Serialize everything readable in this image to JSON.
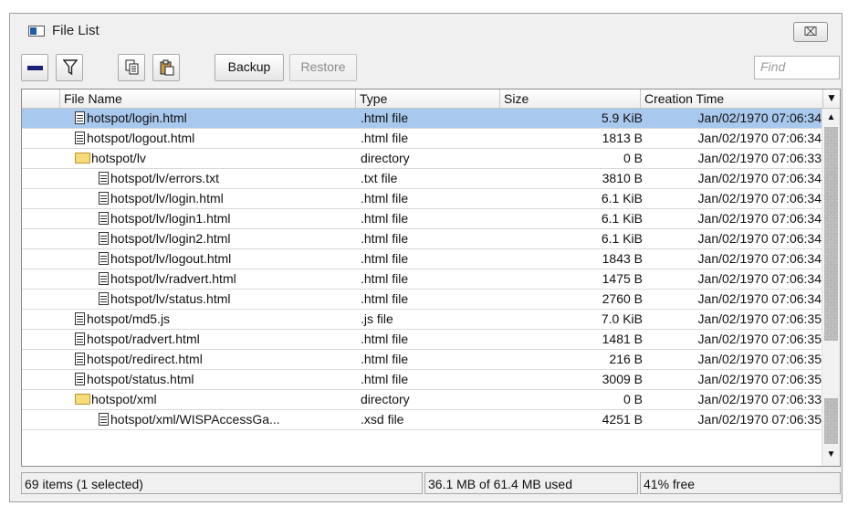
{
  "window": {
    "title": "File List",
    "close_glyph": "⌧"
  },
  "toolbar": {
    "remove_icon": "minus-icon",
    "filter_icon": "filter-icon",
    "copy_icon": "copy-icon",
    "paste_icon": "paste-icon",
    "backup_label": "Backup",
    "restore_label": "Restore",
    "find_placeholder": "Find"
  },
  "table": {
    "columns": [
      "File Name",
      "Type",
      "Size",
      "Creation Time"
    ],
    "sort_indicator": "⁄",
    "menu_glyph": "▼",
    "rows": [
      {
        "name": "hotspot/login.html",
        "type": ".html file",
        "size": "5.9 KiB",
        "time": "Jan/02/1970 07:06:34",
        "icon": "file-icon",
        "indent": 0,
        "selected": true
      },
      {
        "name": "hotspot/logout.html",
        "type": ".html file",
        "size": "1813 B",
        "time": "Jan/02/1970 07:06:34",
        "icon": "file-icon",
        "indent": 0
      },
      {
        "name": "hotspot/lv",
        "type": "directory",
        "size": "0 B",
        "time": "Jan/02/1970 07:06:33",
        "icon": "folder-icon",
        "indent": 0
      },
      {
        "name": "hotspot/lv/errors.txt",
        "type": ".txt file",
        "size": "3810 B",
        "time": "Jan/02/1970 07:06:34",
        "icon": "file-icon",
        "indent": 1
      },
      {
        "name": "hotspot/lv/login.html",
        "type": ".html file",
        "size": "6.1 KiB",
        "time": "Jan/02/1970 07:06:34",
        "icon": "file-icon",
        "indent": 1
      },
      {
        "name": "hotspot/lv/login1.html",
        "type": ".html file",
        "size": "6.1 KiB",
        "time": "Jan/02/1970 07:06:34",
        "icon": "file-icon",
        "indent": 1
      },
      {
        "name": "hotspot/lv/login2.html",
        "type": ".html file",
        "size": "6.1 KiB",
        "time": "Jan/02/1970 07:06:34",
        "icon": "file-icon",
        "indent": 1
      },
      {
        "name": "hotspot/lv/logout.html",
        "type": ".html file",
        "size": "1843 B",
        "time": "Jan/02/1970 07:06:34",
        "icon": "file-icon",
        "indent": 1
      },
      {
        "name": "hotspot/lv/radvert.html",
        "type": ".html file",
        "size": "1475 B",
        "time": "Jan/02/1970 07:06:34",
        "icon": "file-icon",
        "indent": 1
      },
      {
        "name": "hotspot/lv/status.html",
        "type": ".html file",
        "size": "2760 B",
        "time": "Jan/02/1970 07:06:34",
        "icon": "file-icon",
        "indent": 1
      },
      {
        "name": "hotspot/md5.js",
        "type": ".js file",
        "size": "7.0 KiB",
        "time": "Jan/02/1970 07:06:35",
        "icon": "file-icon",
        "indent": 0
      },
      {
        "name": "hotspot/radvert.html",
        "type": ".html file",
        "size": "1481 B",
        "time": "Jan/02/1970 07:06:35",
        "icon": "file-icon",
        "indent": 0
      },
      {
        "name": "hotspot/redirect.html",
        "type": ".html file",
        "size": "216 B",
        "time": "Jan/02/1970 07:06:35",
        "icon": "file-icon",
        "indent": 0
      },
      {
        "name": "hotspot/status.html",
        "type": ".html file",
        "size": "3009 B",
        "time": "Jan/02/1970 07:06:35",
        "icon": "file-icon",
        "indent": 0
      },
      {
        "name": "hotspot/xml",
        "type": "directory",
        "size": "0 B",
        "time": "Jan/02/1970 07:06:33",
        "icon": "folder-icon",
        "indent": 0
      },
      {
        "name": "hotspot/xml/WISPAccessGa...",
        "type": ".xsd file",
        "size": "4251 B",
        "time": "Jan/02/1970 07:06:35",
        "icon": "file-icon",
        "indent": 1
      }
    ]
  },
  "scrollbar": {
    "up_glyph": "▲",
    "down_glyph": "▼"
  },
  "status": {
    "items": "69 items (1 selected)",
    "usage": "36.1 MB of 61.4 MB used",
    "free": "41% free"
  }
}
